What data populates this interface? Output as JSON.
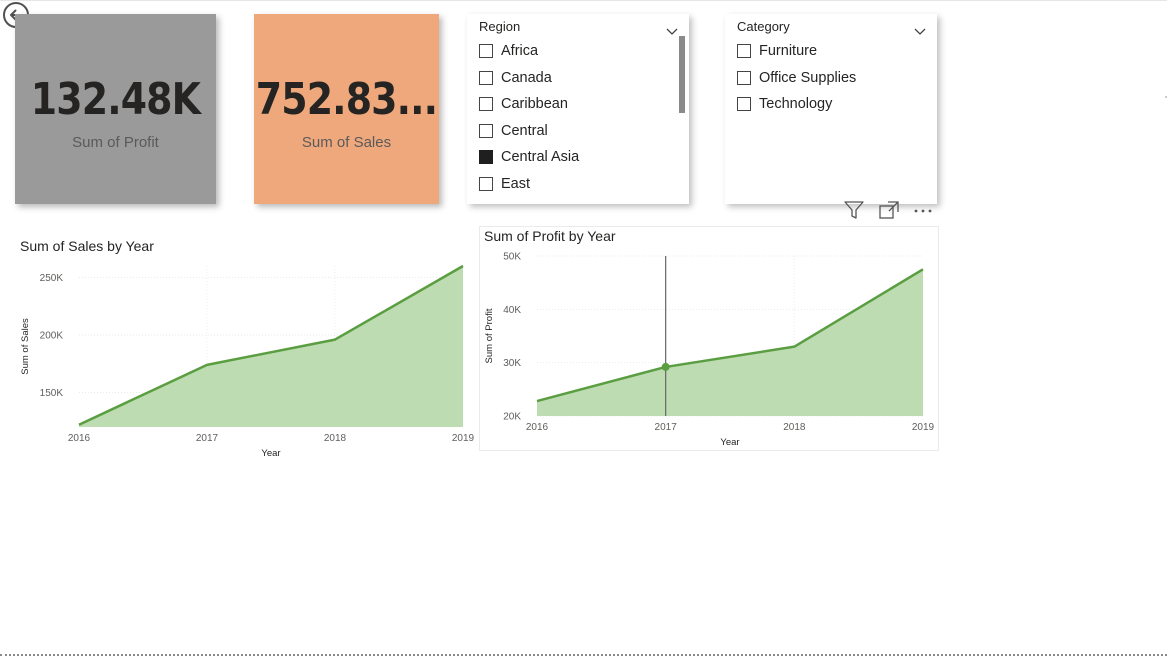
{
  "nav": {
    "back_icon": "back-arrow-icon"
  },
  "cards": {
    "profit": {
      "value": "132.48K",
      "label": "Sum of Profit",
      "bg": "#9a9a9a"
    },
    "sales": {
      "value": "752.83...",
      "label": "Sum of Sales",
      "bg": "#efa87c"
    }
  },
  "region_slicer": {
    "title": "Region",
    "items": [
      {
        "label": "Africa",
        "checked": false
      },
      {
        "label": "Canada",
        "checked": false
      },
      {
        "label": "Caribbean",
        "checked": false
      },
      {
        "label": "Central",
        "checked": false
      },
      {
        "label": "Central Asia",
        "checked": true
      },
      {
        "label": "East",
        "checked": false
      }
    ]
  },
  "category_slicer": {
    "title": "Category",
    "items": [
      {
        "label": "Furniture",
        "checked": false
      },
      {
        "label": "Office Supplies",
        "checked": false
      },
      {
        "label": "Technology",
        "checked": false
      }
    ]
  },
  "visual_header_icons": [
    "filter-icon",
    "focus-mode-icon",
    "more-options-icon"
  ],
  "colors": {
    "line": "#5a9e41",
    "area": "#bddcb2"
  },
  "chart_data": [
    {
      "type": "area",
      "title": "Sum of Sales by Year",
      "xlabel": "Year",
      "ylabel": "Sum of Sales",
      "x": [
        "2016",
        "2017",
        "2018",
        "2019"
      ],
      "series": [
        {
          "values": [
            122000,
            174000,
            196000,
            260000
          ]
        }
      ],
      "yticks": [
        150000,
        200000,
        250000
      ],
      "ytick_labels": [
        "150K",
        "200K",
        "250K"
      ],
      "ylim": [
        120000,
        260000
      ],
      "grid": true
    },
    {
      "type": "area",
      "title": "Sum of Profit by Year",
      "xlabel": "Year",
      "ylabel": "Sum of Profit",
      "x": [
        "2016",
        "2017",
        "2018",
        "2019"
      ],
      "series": [
        {
          "values": [
            22800,
            29200,
            33000,
            47500
          ]
        }
      ],
      "yticks": [
        20000,
        30000,
        40000,
        50000
      ],
      "ytick_labels": [
        "20K",
        "30K",
        "40K",
        "50K"
      ],
      "ylim": [
        20000,
        50000
      ],
      "grid": true,
      "hover_year": "2017"
    }
  ]
}
